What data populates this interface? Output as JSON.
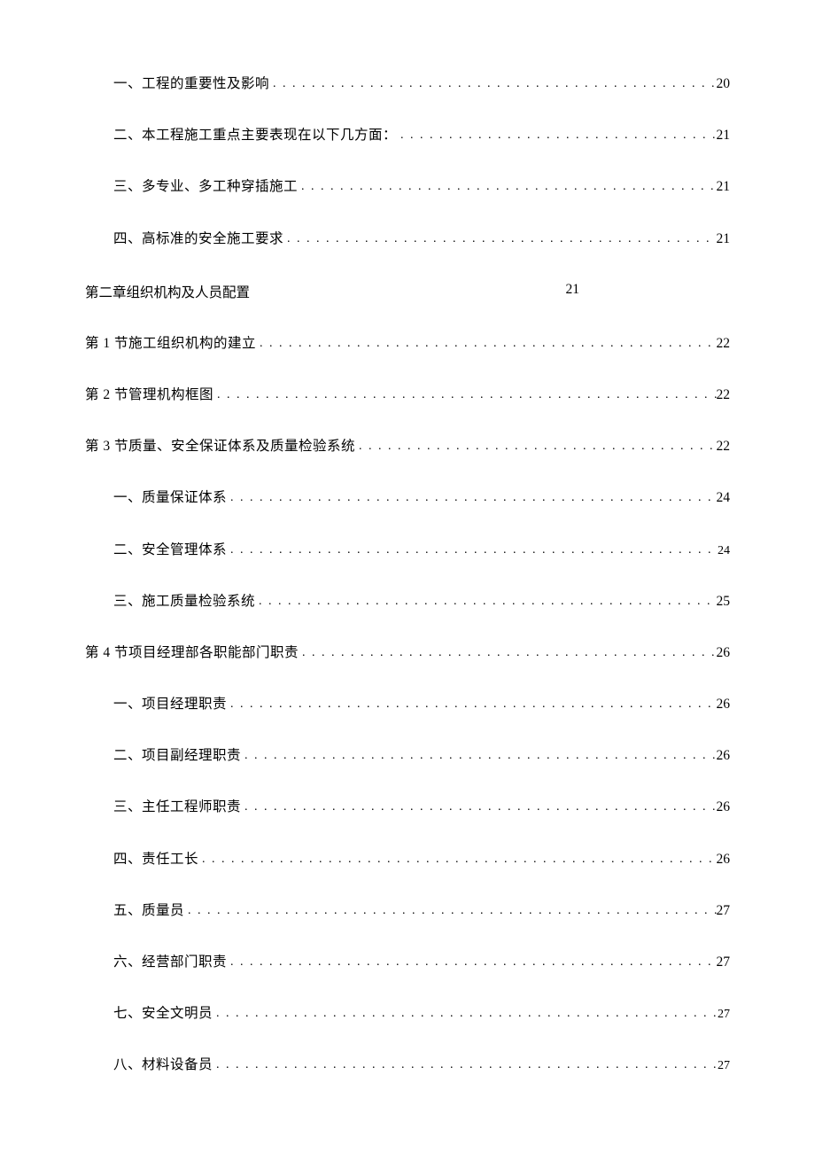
{
  "toc": [
    {
      "label": "一、工程的重要性及影响",
      "page": "20",
      "level": 2,
      "leader": true
    },
    {
      "label": "二、本工程施工重点主要表现在以下几方面：",
      "page": "21",
      "level": 2,
      "leader": true
    },
    {
      "label": "三、多专业、多工种穿插施工",
      "page": "21",
      "level": 2,
      "leader": true
    },
    {
      "label": "四、高标准的安全施工要求",
      "page": "21",
      "level": 2,
      "leader": true
    },
    {
      "label": "第二章组织机构及人员配置",
      "page": "21",
      "level": 1,
      "leader": false,
      "chapter": true
    },
    {
      "label": "第 1 节施工组织机构的建立",
      "page": "22",
      "level": 1,
      "leader": true
    },
    {
      "label": "第 2 节管理机构框图",
      "page": "22",
      "level": 1,
      "leader": true
    },
    {
      "label": "第 3 节质量、安全保证体系及质量检验系统",
      "page": "22",
      "level": 1,
      "leader": true
    },
    {
      "label": "一、质量保证体系",
      "page": "24",
      "level": 2,
      "leader": true
    },
    {
      "label": "二、安全管理体系",
      "page": "24",
      "level": 2,
      "leader": true,
      "smallPage": true
    },
    {
      "label": "三、施工质量检验系统",
      "page": "25",
      "level": 2,
      "leader": true
    },
    {
      "label": "第 4 节项目经理部各职能部门职责",
      "page": "26",
      "level": 1,
      "leader": true
    },
    {
      "label": "一、项目经理职责",
      "page": "26",
      "level": 2,
      "leader": true
    },
    {
      "label": "二、项目副经理职责",
      "page": "26",
      "level": 2,
      "leader": true
    },
    {
      "label": "三、主任工程师职责",
      "page": "26",
      "level": 2,
      "leader": true
    },
    {
      "label": "四、责任工长",
      "page": "26",
      "level": 2,
      "leader": true
    },
    {
      "label": "五、质量员",
      "page": "27",
      "level": 2,
      "leader": true
    },
    {
      "label": "六、经营部门职责",
      "page": "27",
      "level": 2,
      "leader": true
    },
    {
      "label": "七、安全文明员",
      "page": "27",
      "level": 2,
      "leader": true,
      "smallPage": true
    },
    {
      "label": "八、材料设备员",
      "page": "27",
      "level": 2,
      "leader": true,
      "smallPage": true
    }
  ]
}
